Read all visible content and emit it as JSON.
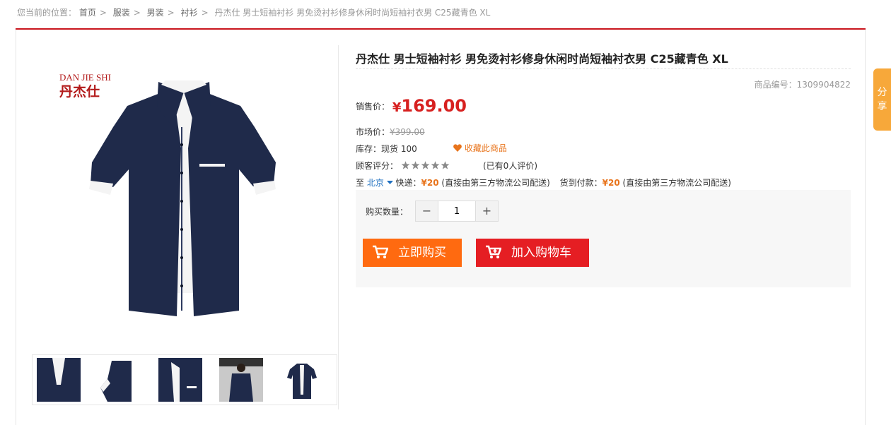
{
  "breadcrumb": {
    "prefix": "您当前的位置：",
    "items": [
      "首页",
      "服装",
      "男装",
      "衬衫"
    ],
    "separator": ">",
    "current": "丹杰仕 男士短袖衬衫 男免烫衬衫修身休闲时尚短袖衬衣男 C25藏青色 XL"
  },
  "product": {
    "brand_text": "DAN JIE SHI",
    "brand_cn": "丹杰仕",
    "title": "丹杰仕 男士短袖衬衫 男免烫衬衫修身休闲时尚短袖衬衣男 C25藏青色 XL",
    "sku_label": "商品编号：",
    "sku": "1309904822",
    "sale_price_label": "销售价：",
    "sale_price_currency": "¥",
    "sale_price": "169.00",
    "market_price_label": "市场价：",
    "market_price": "¥399.00",
    "stock_label": "库存：",
    "stock_value": "现货 100",
    "favorite_label": "收藏此商品",
    "rating_label": "顾客评分：",
    "rating": 5,
    "rating_max": 5,
    "review_count_text": "(已有0人评价)",
    "delivery": {
      "to_label": "至",
      "city": "北京",
      "express_label": "快递：",
      "express_price": "¥20",
      "express_note": "(直接由第三方物流公司配送)",
      "cod_label": "货到付款：",
      "cod_price": "¥20",
      "cod_note": "(直接由第三方物流公司配送)"
    }
  },
  "buy": {
    "qty_label": "购买数量：",
    "minus": "−",
    "plus": "+",
    "qty_value": "1",
    "buy_now": "立即购买",
    "add_cart": "加入购物车"
  },
  "share": {
    "label": "分享"
  },
  "colors": {
    "accent_red": "#c9151e",
    "price_red": "#d7201f",
    "buy_orange": "#ff6a10",
    "cart_red": "#e51e23",
    "share_orange": "#f7a83a",
    "shirt_navy": "#1f2a4a"
  },
  "thumbnails": [
    "shirt-detail-collar",
    "shirt-detail-sleeve",
    "shirt-detail-pocket",
    "shirt-back-view",
    "shirt-front-view"
  ]
}
